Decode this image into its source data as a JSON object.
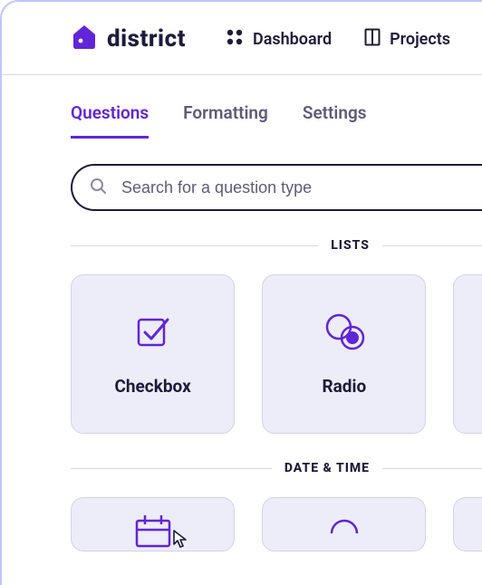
{
  "brand": {
    "name": "district"
  },
  "nav": {
    "dashboard": "Dashboard",
    "projects": "Projects"
  },
  "tabs": {
    "questions": "Questions",
    "formatting": "Formatting",
    "settings": "Settings"
  },
  "search": {
    "placeholder": "Search for a question type"
  },
  "sections": {
    "lists": "LISTS",
    "datetime": "DATE & TIME"
  },
  "tiles": {
    "checkbox": "Checkbox",
    "radio": "Radio"
  }
}
